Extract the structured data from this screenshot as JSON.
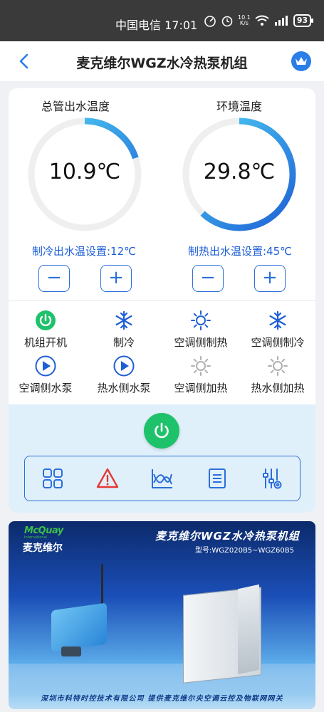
{
  "status_bar": {
    "carrier_time": "中国电信 17:01",
    "net_speed_top": "10.1",
    "net_speed_bottom": "K/s",
    "battery": "93"
  },
  "header": {
    "title": "麦克维尔WGZ水冷热泵机组"
  },
  "gauges": [
    {
      "label": "总管出水温度",
      "value": "10.9℃",
      "fraction": 0.2,
      "setpoint": "制冷出水温设置:12℃"
    },
    {
      "label": "环境温度",
      "value": "29.8℃",
      "fraction": 0.62,
      "setpoint": "制热出水温设置:45℃"
    }
  ],
  "steppers": {
    "minus": "−",
    "plus": "+"
  },
  "status_items": [
    {
      "label": "机组开机",
      "icon": "power-icon",
      "active": true
    },
    {
      "label": "制冷",
      "icon": "snowflake-icon",
      "active": true
    },
    {
      "label": "空调侧制热",
      "icon": "sun-icon",
      "active": true
    },
    {
      "label": "空调侧制冷",
      "icon": "snowflake-icon",
      "active": true
    },
    {
      "label": "空调侧水泵",
      "icon": "pump-icon",
      "active": true
    },
    {
      "label": "热水侧水泵",
      "icon": "pump-icon",
      "active": true
    },
    {
      "label": "空调侧加热",
      "icon": "sun-icon",
      "active": false
    },
    {
      "label": "热水侧加热",
      "icon": "sun-icon",
      "active": false
    }
  ],
  "toolbar": [
    "grid-icon",
    "warning-icon",
    "chart-icon",
    "list-icon",
    "settings-icon"
  ],
  "banner": {
    "brand_en": "McQuay",
    "brand_sub": "International",
    "brand_cn": "麦克维尔",
    "title": "麦克维尔WGZ水冷热泵机组",
    "model": "型号:WGZ020B5~WGZ60B5",
    "footer": "深圳市科特时控技术有限公司    提供麦克维尔央空调云控及物联网网关"
  },
  "colors": {
    "accent": "#2b6fd8",
    "gauge_track": "#efefef",
    "gauge_arc_start": "#1e5fd6",
    "gauge_arc_end": "#4fd4f4",
    "power_green": "#1ec26a",
    "alarm_red": "#e53935",
    "inactive_gray": "#b0b0b0"
  }
}
